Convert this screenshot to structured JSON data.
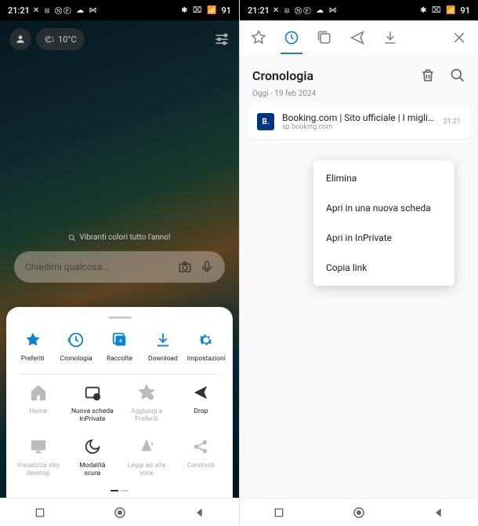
{
  "status": {
    "time": "21:21",
    "battery": "91"
  },
  "left": {
    "temp": "10°C",
    "caption": "Vibranti colori tutto l'anno!",
    "search_placeholder": "Chiedimi qualcosa...",
    "sheet_row1": [
      {
        "label": "Preferiti"
      },
      {
        "label": "Cronologia"
      },
      {
        "label": "Raccolte"
      },
      {
        "label": "Download"
      },
      {
        "label": "Impostazioni"
      }
    ],
    "sheet_row2": [
      {
        "label": "Home"
      },
      {
        "label": "Nuova scheda InPrivate"
      },
      {
        "label": "Aggiungi a Preferiti"
      },
      {
        "label": "Drop"
      }
    ],
    "sheet_row3": [
      {
        "label": "Visualizza sito desktop"
      },
      {
        "label": "Modalità scura"
      },
      {
        "label": "Leggi ad alta voce"
      },
      {
        "label": "Condividi"
      }
    ]
  },
  "right": {
    "title": "Cronologia",
    "date": "Oggi - 19 feb 2024",
    "history": {
      "favicon_text": "B.",
      "title": "Booking.com | Sito ufficiale | I migliori ho...",
      "url": "sp.booking.com",
      "time": "21:21"
    },
    "menu": [
      "Elimina",
      "Apri in una nuova scheda",
      "Apri in InPrivate",
      "Copia link"
    ]
  }
}
